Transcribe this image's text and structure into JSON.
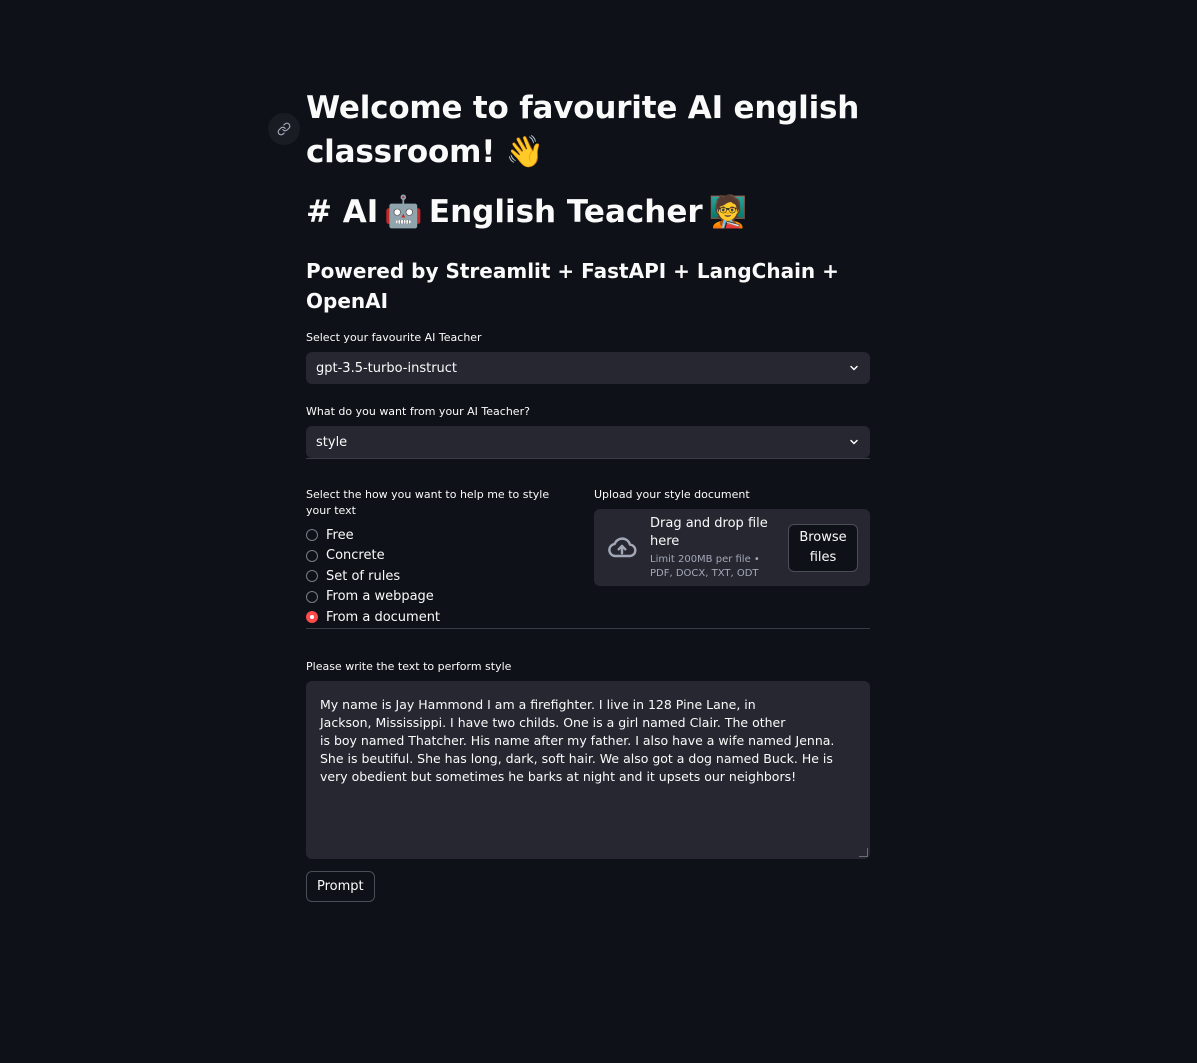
{
  "header": {
    "welcome_title": "Welcome to favourite AI english classroom! 👋",
    "teacher_title_prefix": "# AI",
    "teacher_robot": "🤖",
    "teacher_title_main": "English Teacher",
    "teacher_emoji": "🧑‍🏫",
    "powered_by": "Powered by Streamlit + FastAPI + LangChain + OpenAI"
  },
  "teacher_select": {
    "label": "Select your favourite AI Teacher",
    "value": "gpt-3.5-turbo-instruct"
  },
  "task_select": {
    "label": "What do you want from your AI Teacher?",
    "value": "style"
  },
  "style_radio": {
    "label": "Select the how you want to help me to style your text",
    "options": [
      "Free",
      "Concrete",
      "Set of rules",
      "From a webpage",
      "From a document"
    ],
    "selected": "From a document"
  },
  "upload": {
    "label": "Upload your style document",
    "drop_title": "Drag and drop file here",
    "drop_subtitle": "Limit 200MB per file • PDF, DOCX, TXT, ODT",
    "browse_label": "Browse files"
  },
  "text_input": {
    "label": "Please write the text to perform style",
    "value": "My name is Jay Hammond I am a firefighter. I live in 128 Pine Lane, in\nJackson, Mississippi. I have two childs. One is a girl named Clair. The other\nis boy named Thatcher. His name after my father. I also have a wife named Jenna.\nShe is beutiful. She has long, dark, soft hair. We also got a dog named Buck. He is\nvery obedient but sometimes he barks at night and it upsets our neighbors!"
  },
  "prompt_button": {
    "label": "Prompt"
  },
  "icons": {
    "anchor": "link-icon",
    "dropdown": "chevron-down-icon",
    "upload": "cloud-upload-icon"
  },
  "colors": {
    "background": "#0e1117",
    "widget": "#262730",
    "accent": "#ff4b4b"
  }
}
